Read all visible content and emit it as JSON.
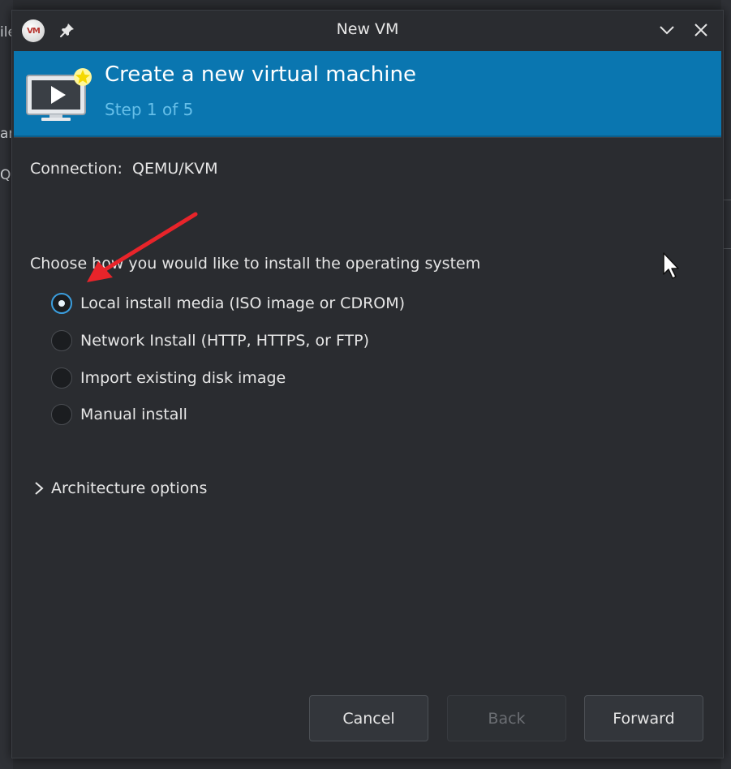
{
  "background_app": {
    "fragments": [
      "ile",
      "ar",
      "Q"
    ]
  },
  "window": {
    "title": "New VM",
    "app_icon_text": "VM"
  },
  "banner": {
    "title": "Create a new virtual machine",
    "step": "Step 1 of 5"
  },
  "connection": {
    "label": "Connection:",
    "value": "QEMU/KVM"
  },
  "install": {
    "prompt": "Choose how you would like to install the operating system",
    "options": [
      {
        "label": "Local install media (ISO image or CDROM)",
        "checked": true
      },
      {
        "label": "Network Install (HTTP, HTTPS, or FTP)",
        "checked": false
      },
      {
        "label": "Import existing disk image",
        "checked": false
      },
      {
        "label": "Manual install",
        "checked": false
      }
    ]
  },
  "architecture": {
    "label": "Architecture options"
  },
  "buttons": {
    "cancel": "Cancel",
    "back": "Back",
    "forward": "Forward"
  },
  "colors": {
    "banner": "#0a76b0",
    "step_text": "#66bfe9",
    "radio_accent": "#3b9ede",
    "annotation_arrow": "#e8242a"
  }
}
